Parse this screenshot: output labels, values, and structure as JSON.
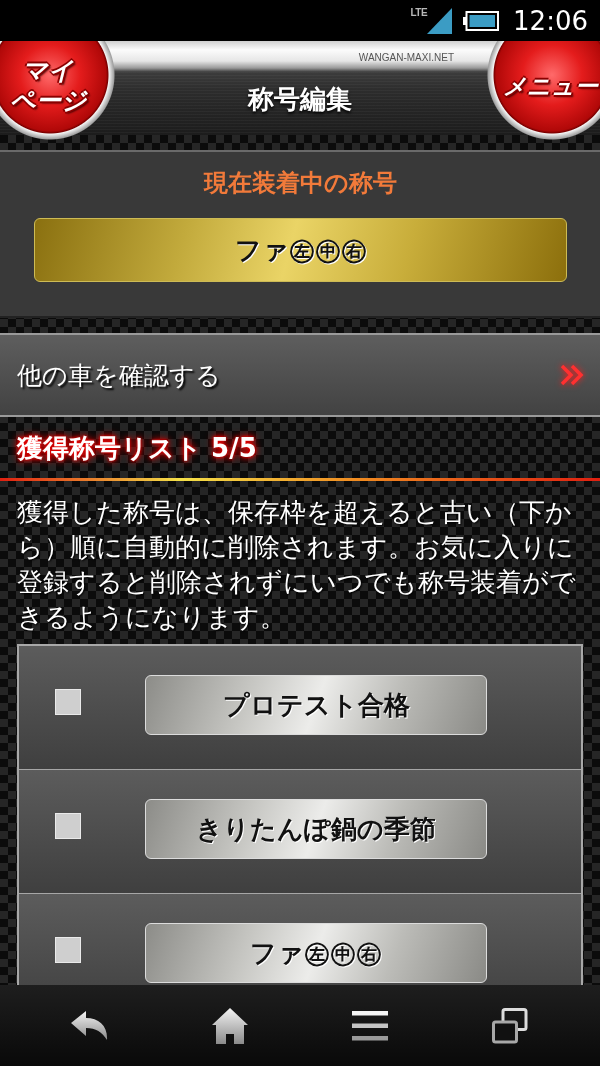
{
  "status_bar": {
    "network": "LTE",
    "time": "12:06"
  },
  "header": {
    "title": "称号編集",
    "site_label": "WANGAN-MAXI.NET",
    "left_button": {
      "lines": [
        "マイ",
        "ページ"
      ]
    },
    "right_button": {
      "label": "メニュー"
    }
  },
  "current_title": {
    "heading": "現在装着中の称号",
    "name": "ファ㊧㊥㊨"
  },
  "other_cars": {
    "label": "他の車を確認する"
  },
  "title_list": {
    "heading": "獲得称号リスト 5/5",
    "description": "獲得した称号は、保存枠を超えると古い（下から）順に自動的に削除されます。お気に入りに登録すると削除されずにいつでも称号装着ができるようになります。",
    "items": [
      {
        "name": "プロテスト合格",
        "checked": false
      },
      {
        "name": "きりたんぽ鍋の季節",
        "checked": false
      },
      {
        "name": "ファ㊧㊥㊨",
        "checked": false
      }
    ]
  }
}
